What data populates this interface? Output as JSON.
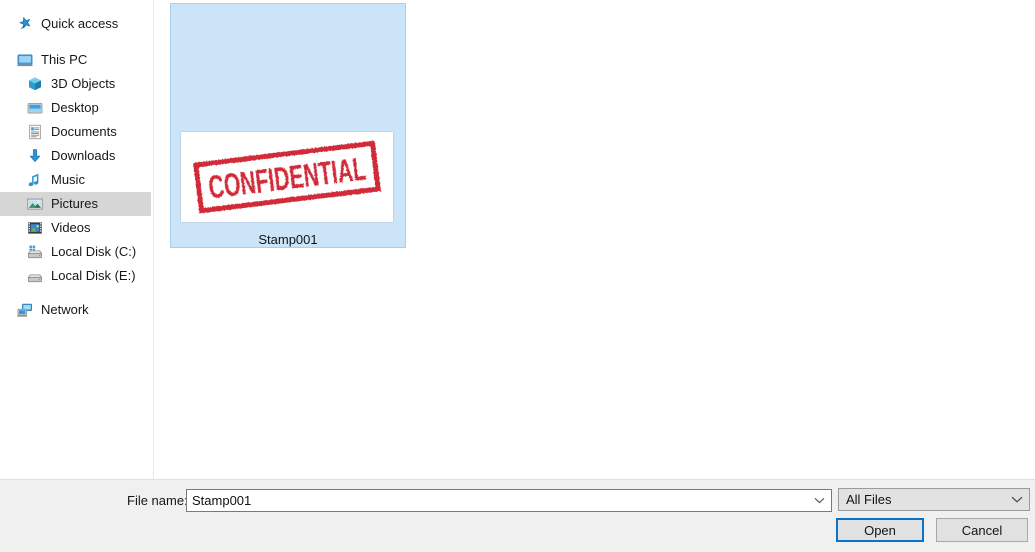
{
  "dialog": {
    "type": "file-open-dialog"
  },
  "nav_pane": {
    "groups": [
      {
        "items": [
          {
            "label": "Quick access",
            "icon": "quick-access-star-icon",
            "indent": false,
            "selected": false
          }
        ]
      },
      {
        "items": [
          {
            "label": "This PC",
            "icon": "this-pc-monitor-icon",
            "indent": false,
            "selected": false
          },
          {
            "label": "3D Objects",
            "icon": "3d-objects-cube-icon",
            "indent": true,
            "selected": false
          },
          {
            "label": "Desktop",
            "icon": "desktop-monitor-icon",
            "indent": true,
            "selected": false
          },
          {
            "label": "Documents",
            "icon": "documents-page-icon",
            "indent": true,
            "selected": false
          },
          {
            "label": "Downloads",
            "icon": "downloads-arrow-icon",
            "indent": true,
            "selected": false
          },
          {
            "label": "Music",
            "icon": "music-note-icon",
            "indent": true,
            "selected": false
          },
          {
            "label": "Pictures",
            "icon": "pictures-photo-icon",
            "indent": true,
            "selected": true
          },
          {
            "label": "Videos",
            "icon": "videos-film-icon",
            "indent": true,
            "selected": false
          },
          {
            "label": "Local Disk (C:)",
            "icon": "local-disk-c-drive-icon",
            "indent": true,
            "selected": false
          },
          {
            "label": "Local Disk (E:)",
            "icon": "local-disk-e-drive-icon",
            "indent": true,
            "selected": false
          }
        ]
      },
      {
        "items": [
          {
            "label": "Network",
            "icon": "network-icon",
            "indent": false,
            "selected": false
          }
        ]
      }
    ]
  },
  "file_list": {
    "items": [
      {
        "name": "Stamp001",
        "selected": true,
        "thumbnail": {
          "kind": "image-thumbnail",
          "stamp_text": "CONFIDENTIAL",
          "stamp_color": "#d12b38",
          "background": "#ffffff",
          "rotation_deg": -7
        }
      }
    ]
  },
  "bottom_bar": {
    "filename_label": "File name:",
    "filename_value": "Stamp001",
    "filename_placeholder": "File name",
    "filetype_value": "All Files",
    "open_label": "Open",
    "cancel_label": "Cancel"
  },
  "colors": {
    "selection_fill": "#cce4f7",
    "selection_border": "#a6d0ef",
    "nav_selected": "#d6d6d6",
    "focus_border": "#0a74c8",
    "bar_background": "#f0f0f0",
    "stamp_red": "#d12b38"
  }
}
